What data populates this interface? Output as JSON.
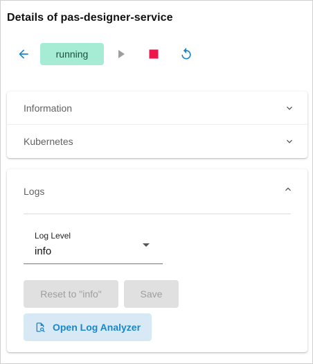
{
  "page": {
    "title": "Details of pas-designer-service"
  },
  "toolbar": {
    "back_icon": "arrow-left-icon",
    "status_label": "running",
    "play_icon": "play-icon",
    "stop_icon": "stop-icon",
    "restart_icon": "restart-icon"
  },
  "panels": [
    {
      "label": "Information",
      "icon": "chevron-down-icon"
    },
    {
      "label": "Kubernetes",
      "icon": "chevron-down-icon"
    }
  ],
  "logs": {
    "label": "Logs",
    "icon": "chevron-up-icon",
    "log_level": {
      "label": "Log Level",
      "value": "info"
    },
    "reset_label": "Reset to \"info\"",
    "save_label": "Save",
    "analyzer_label": "Open Log Analyzer",
    "analyzer_icon": "document-search-icon"
  },
  "colors": {
    "accent": "#1c86c8",
    "status_bg": "#a6ecd5",
    "status_text": "#17503c",
    "stop": "#f0124a",
    "play_disabled": "#9e9e9e",
    "disabled_bg": "#e0e0e0",
    "analyzer_bg": "#d6e9f4"
  }
}
